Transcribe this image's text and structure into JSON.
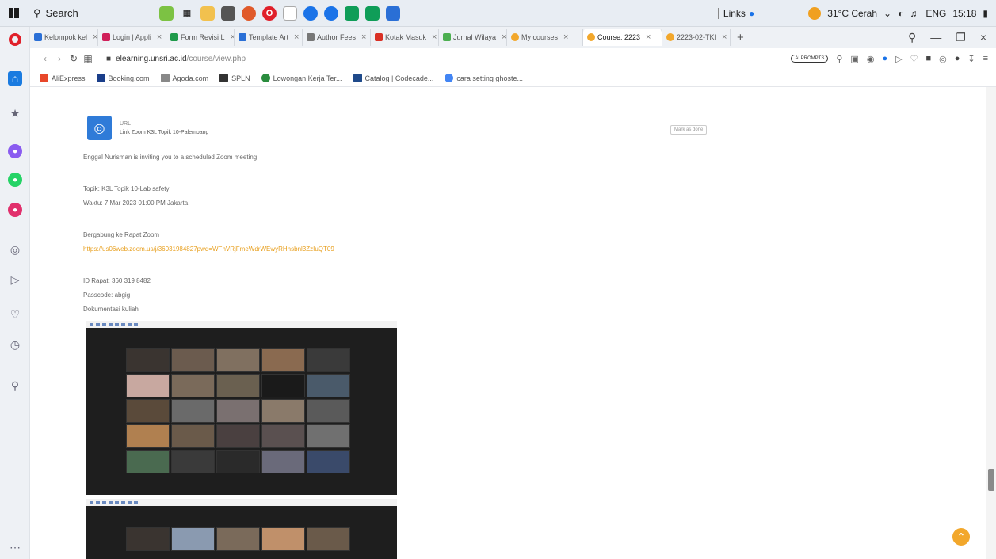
{
  "taskbar": {
    "search_label": "Search",
    "links_label": "Links",
    "weather": "31°C Cerah",
    "language": "ENG",
    "time": "15:18"
  },
  "tabs": [
    {
      "label": "Kelompok kel",
      "color": "#2a6fd6"
    },
    {
      "label": "Login | Appli",
      "color": "#d0205a"
    },
    {
      "label": "Form Revisi L",
      "color": "#1f9a4a"
    },
    {
      "label": "Template Art",
      "color": "#2a6fd6"
    },
    {
      "label": "Author Fees",
      "color": "#777777"
    },
    {
      "label": "Kotak Masuk",
      "color": "#d93025"
    },
    {
      "label": "Jurnal Wilaya",
      "color": "#4caf50"
    },
    {
      "label": "My courses",
      "color": "#f2a72b"
    },
    {
      "label": "Course: 2223",
      "color": "#f2a72b",
      "active": true
    },
    {
      "label": "2223-02-TKI",
      "color": "#f2a72b"
    }
  ],
  "address": {
    "url_domain": "elearning.unsri.ac.id",
    "url_path": "/course/view.php",
    "ai_badge": "AI PROMPTS"
  },
  "bookmarks": [
    {
      "label": "AliExpress",
      "color": "#e8472a"
    },
    {
      "label": "Booking.com",
      "color": "#1a3e8a"
    },
    {
      "label": "Agoda.com",
      "color": "#888888"
    },
    {
      "label": "SPLN",
      "color": "#333333"
    },
    {
      "label": "Lowongan Kerja Ter...",
      "color": "#2a8c3e"
    },
    {
      "label": "Catalog | Codecade...",
      "color": "#1f4a8a"
    },
    {
      "label": "cara setting ghoste...",
      "color": "#4285f4"
    }
  ],
  "activity": {
    "type_label": "URL",
    "name": "Link Zoom K3L Topik 10-Palembang",
    "mark_done": "Mark as done"
  },
  "content": {
    "invite": "Enggal Nurisman is inviting you to a scheduled Zoom meeting.",
    "topic": "Topik: K3L Topik 10-Lab safety",
    "time": "Waktu: 7 Mar 2023 01:00 PM Jakarta",
    "join_label": "Bergabung ke Rapat Zoom",
    "join_link": "https://us06web.zoom.us/j/36031984827pwd=WFhVRjFmeWdrWEwyRHhsbnl3ZzIuQT09",
    "meeting_id": "ID Rapat: 360 319 8482",
    "passcode": "Passcode: abgig",
    "docs_label": "Dokumentasi kuliah"
  },
  "tile_colors_1": [
    "#3a3430",
    "#6b5b4e",
    "#807060",
    "#8a6a50",
    "#3a3a3a",
    "#c8a8a0",
    "#7a6a5a",
    "#6a6050",
    "#1a1a1a",
    "#4a5a6a",
    "#5a4a3a",
    "#6a6a6a",
    "#7a7070",
    "#8a7a6a",
    "#5a5a5a",
    "#b08050",
    "#6a5a4a",
    "#4a4040",
    "#5a5050",
    "#707070",
    "#4a6a50",
    "#3a3a3a",
    "#2a2a2a",
    "#6a6a7a",
    "#3a4a6a"
  ],
  "tile_colors_2": [
    "#3a3430",
    "#8a9ab0",
    "#7a6a5a",
    "#c0906a",
    "#6a5a4a"
  ]
}
